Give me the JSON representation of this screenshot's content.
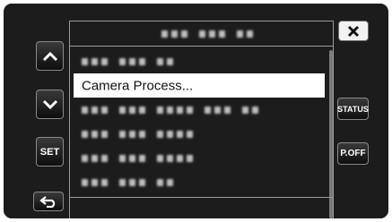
{
  "left_buttons": {
    "up_icon": "chevron-up-icon",
    "down_icon": "chevron-down-icon",
    "set_label": "SET",
    "back_icon": "return-arrow-icon"
  },
  "right_buttons": {
    "close_icon": "close-icon",
    "status_label": "STATUS",
    "poff_label": "P.OFF"
  },
  "menu": {
    "selected_item_label": "Camera Process..."
  },
  "colors": {
    "background": "#1c1c1c",
    "selected_row": "#ffffff",
    "border": "#9a9a9a"
  }
}
